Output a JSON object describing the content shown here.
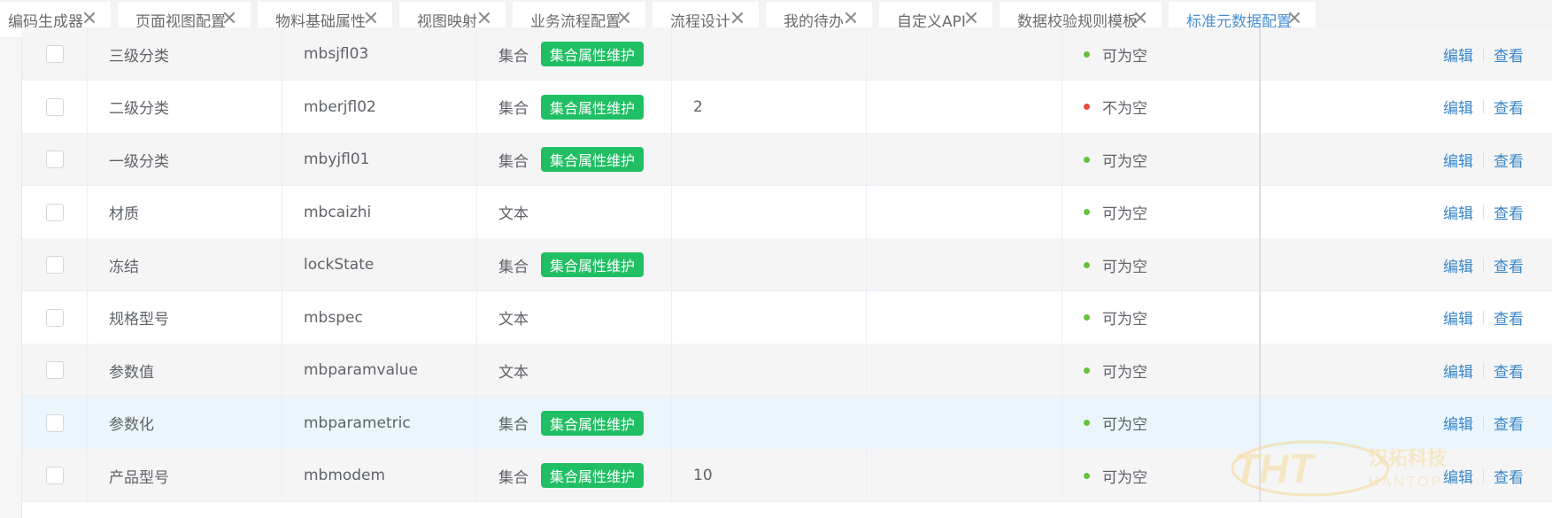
{
  "tabs": [
    {
      "label": "编码生成器",
      "active": false
    },
    {
      "label": "页面视图配置",
      "active": false
    },
    {
      "label": "物料基础属性",
      "active": false
    },
    {
      "label": "视图映射",
      "active": false
    },
    {
      "label": "业务流程配置",
      "active": false
    },
    {
      "label": "流程设计",
      "active": false
    },
    {
      "label": "我的待办",
      "active": false
    },
    {
      "label": "自定义API",
      "active": false
    },
    {
      "label": "数据校验规则模板",
      "active": false
    },
    {
      "label": "标准元数据配置",
      "active": true
    }
  ],
  "tag_label": "集合属性维护",
  "actions": {
    "edit": "编辑",
    "view": "查看"
  },
  "colors": {
    "ok": "#67c23a",
    "danger": "#e74c3c",
    "tag": "#20bf63",
    "link": "#3a87c9",
    "active_tab": "#4a8ecf"
  },
  "rows": [
    {
      "name": "三级分类",
      "code": "mbsjfl03",
      "type": "集合",
      "has_tag": true,
      "length": "",
      "nullable": "可为空",
      "nullable_ok": true
    },
    {
      "name": "二级分类",
      "code": "mberjfl02",
      "type": "集合",
      "has_tag": true,
      "length": "2",
      "nullable": "不为空",
      "nullable_ok": false
    },
    {
      "name": "一级分类",
      "code": "mbyjfl01",
      "type": "集合",
      "has_tag": true,
      "length": "",
      "nullable": "可为空",
      "nullable_ok": true
    },
    {
      "name": "材质",
      "code": "mbcaizhi",
      "type": "文本",
      "has_tag": false,
      "length": "",
      "nullable": "可为空",
      "nullable_ok": true
    },
    {
      "name": "冻结",
      "code": "lockState",
      "type": "集合",
      "has_tag": true,
      "length": "",
      "nullable": "可为空",
      "nullable_ok": true
    },
    {
      "name": "规格型号",
      "code": "mbspec",
      "type": "文本",
      "has_tag": false,
      "length": "",
      "nullable": "可为空",
      "nullable_ok": true
    },
    {
      "name": "参数值",
      "code": "mbparamvalue",
      "type": "文本",
      "has_tag": false,
      "length": "",
      "nullable": "可为空",
      "nullable_ok": true
    },
    {
      "name": "参数化",
      "code": "mbparametric",
      "type": "集合",
      "has_tag": true,
      "length": "",
      "nullable": "可为空",
      "nullable_ok": true,
      "hovered": true
    },
    {
      "name": "产品型号",
      "code": "mbmodem",
      "type": "集合",
      "has_tag": true,
      "length": "10",
      "nullable": "可为空",
      "nullable_ok": true
    }
  ],
  "watermark": {
    "mark": "THT",
    "text_cn": "汉拓科技",
    "text_en": "HANTOP"
  }
}
